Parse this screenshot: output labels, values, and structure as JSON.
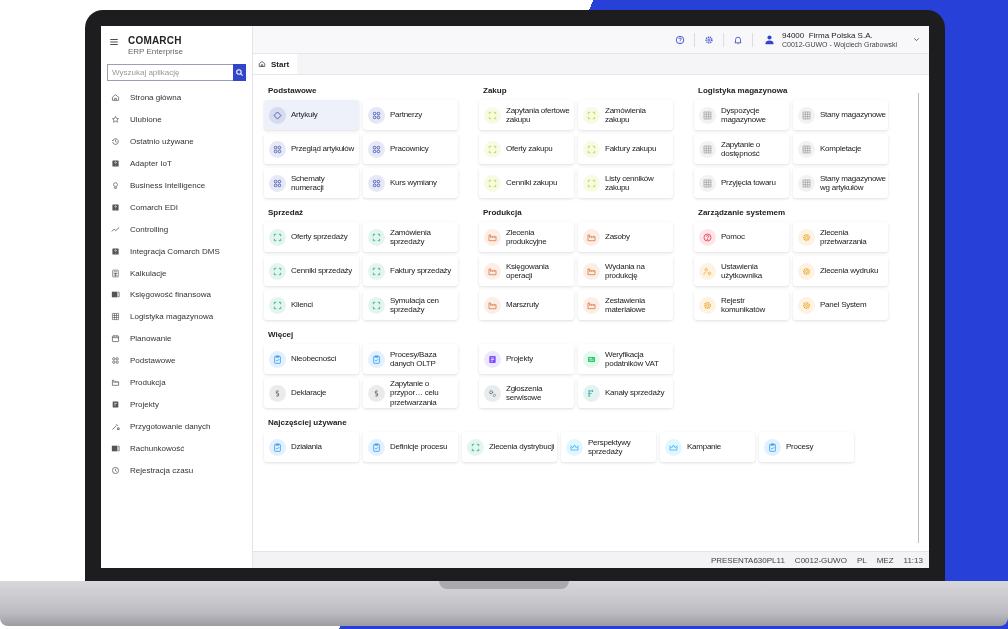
{
  "sidebar": {
    "brand": "COMARCH",
    "subtitle": "ERP Enterprise",
    "search": {
      "placeholder": "Wyszukaj aplikację"
    },
    "items": [
      {
        "label": "Strona główna",
        "kind": "home"
      },
      {
        "label": "Ulubione",
        "kind": "star"
      },
      {
        "label": "Ostatnio używane",
        "kind": "history"
      },
      {
        "label": "Adapter IoT",
        "kind": "qbox"
      },
      {
        "label": "Business Intelligence",
        "kind": "bulb"
      },
      {
        "label": "Comarch EDI",
        "kind": "qbox"
      },
      {
        "label": "Controlling",
        "kind": "trend"
      },
      {
        "label": "Integracja Comarch DMS",
        "kind": "qbox"
      },
      {
        "label": "Kalkulacje",
        "kind": "calc"
      },
      {
        "label": "Księgowość finansowa",
        "kind": "ledger"
      },
      {
        "label": "Logistyka magazynowa",
        "kind": "grid"
      },
      {
        "label": "Planowanie",
        "kind": "calendar"
      },
      {
        "label": "Podstawowe",
        "kind": "apps"
      },
      {
        "label": "Produkcja",
        "kind": "factory"
      },
      {
        "label": "Projekty",
        "kind": "project"
      },
      {
        "label": "Przygotowanie danych",
        "kind": "wand"
      },
      {
        "label": "Rachunkowość",
        "kind": "ledger"
      },
      {
        "label": "Rejestracja czasu",
        "kind": "clock"
      }
    ]
  },
  "header": {
    "company": "94000  Firma Polska S.A.",
    "user": "C0012-GUWO - Wojciech Grabowski"
  },
  "tabs": [
    {
      "label": "Start",
      "selected": true
    }
  ],
  "sections": [
    {
      "title": "Podstawowe",
      "tiles": [
        {
          "label": "Artykuły",
          "kind": "diamond",
          "selected": true
        },
        {
          "label": "Partnerzy",
          "kind": "apps",
          "selected": false
        },
        {
          "label": "Przegląd artykułów",
          "kind": "apps",
          "selected": false
        },
        {
          "label": "Pracownicy",
          "kind": "apps",
          "selected": false
        },
        {
          "label": "Schematy numeracji",
          "kind": "apps",
          "selected": false
        },
        {
          "label": "Kurs wymiany",
          "kind": "apps",
          "selected": false
        }
      ]
    },
    {
      "title": "Zakup",
      "tiles": [
        {
          "label": "Zapytania ofertowe zakupu",
          "kind": "purchase",
          "selected": false
        },
        {
          "label": "Zamówienia zakupu",
          "kind": "purchase",
          "selected": false
        },
        {
          "label": "Oferty zakupu",
          "kind": "purchase",
          "selected": false
        },
        {
          "label": "Faktury zakupu",
          "kind": "purchase",
          "selected": false
        },
        {
          "label": "Cenniki zakupu",
          "kind": "purchase",
          "selected": false
        },
        {
          "label": "Listy cenników zakupu",
          "kind": "purchase",
          "selected": false
        }
      ]
    },
    {
      "title": "Logistyka magazynowa",
      "tiles": [
        {
          "label": "Dyspozycje magazynowe",
          "kind": "grid",
          "selected": false
        },
        {
          "label": "Stany magazynowe",
          "kind": "grid",
          "selected": false
        },
        {
          "label": "Zapytanie o dostępność",
          "kind": "grid",
          "selected": false
        },
        {
          "label": "Kompletacje",
          "kind": "grid",
          "selected": false
        },
        {
          "label": "Przyjęcia towaru",
          "kind": "grid",
          "selected": false
        },
        {
          "label": "Stany magazynowe wg artykułów",
          "kind": "grid",
          "selected": false
        }
      ]
    },
    {
      "title": "Sprzedaż",
      "tiles": [
        {
          "label": "Oferty sprzedaży",
          "kind": "sales",
          "selected": false
        },
        {
          "label": "Zamówienia sprzedaży",
          "kind": "sales",
          "selected": false
        },
        {
          "label": "Cenniki sprzedaży",
          "kind": "sales",
          "selected": false
        },
        {
          "label": "Faktury sprzedaży",
          "kind": "sales",
          "selected": false
        },
        {
          "label": "Klienci",
          "kind": "sales",
          "selected": false
        },
        {
          "label": "Symulacja cen sprzedaży",
          "kind": "sales",
          "selected": false
        }
      ]
    },
    {
      "title": "Produkcja",
      "tiles": [
        {
          "label": "Zlecenia produkcyjne",
          "kind": "factory",
          "selected": false
        },
        {
          "label": "Zasoby",
          "kind": "factory",
          "selected": false
        },
        {
          "label": "Księgowania operacji",
          "kind": "factory",
          "selected": false
        },
        {
          "label": "Wydania na produkcję",
          "kind": "factory",
          "selected": false
        },
        {
          "label": "Marszruty",
          "kind": "factory",
          "selected": false
        },
        {
          "label": "Zestawienia materiałowe",
          "kind": "factory",
          "selected": false
        }
      ]
    },
    {
      "title": "Zarządzanie systemem",
      "tiles": [
        {
          "label": "Pomoc",
          "kind": "help",
          "selected": false
        },
        {
          "label": "Zlecenia przetwarzania",
          "kind": "gear",
          "selected": false
        },
        {
          "label": "Ustawienia użytkownika",
          "kind": "usergear",
          "selected": false
        },
        {
          "label": "Zlecenia wydruku",
          "kind": "gear",
          "selected": false
        },
        {
          "label": "Rejestr komunikatów",
          "kind": "gear",
          "selected": false
        },
        {
          "label": "Panel System",
          "kind": "gear",
          "selected": false
        }
      ]
    }
  ],
  "more": {
    "title": "Więcej",
    "tiles": [
      {
        "label": "Nieobecności",
        "kind": "clipboard",
        "selected": false
      },
      {
        "label": "Procesy/Baza danych OLTP",
        "kind": "clipboard",
        "selected": false
      },
      {
        "label": "Projekty",
        "kind": "board",
        "selected": false
      },
      {
        "label": "Weryfikacja podatników VAT",
        "kind": "vat",
        "selected": false
      },
      {
        "label": "Deklaracje",
        "kind": "paragraph",
        "selected": false
      },
      {
        "label": "Zapytanie o przypor… celu przetwarzania",
        "kind": "paragraph",
        "selected": false
      },
      {
        "label": "Zgłoszenia serwisowe",
        "kind": "cogs",
        "selected": false
      },
      {
        "label": "Kanały sprzedaży",
        "kind": "branch",
        "selected": false
      }
    ]
  },
  "most_used": {
    "title": "Najczęściej używane",
    "tiles": [
      {
        "label": "Działania",
        "kind": "clipboard",
        "selected": false
      },
      {
        "label": "Definicje procesu",
        "kind": "clipboard",
        "selected": false
      },
      {
        "label": "Zlecenia dystrybucji",
        "kind": "sales",
        "selected": false
      },
      {
        "label": "Perspektywy sprzedaży",
        "kind": "crown",
        "selected": false
      },
      {
        "label": "Kampanie",
        "kind": "crown",
        "selected": false
      },
      {
        "label": "Procesy",
        "kind": "clipboard",
        "selected": false
      }
    ]
  },
  "status_bar": [
    "PRESENTA630PL11",
    "C0012-GUWO",
    "PL",
    "MEZ",
    "11:13"
  ]
}
